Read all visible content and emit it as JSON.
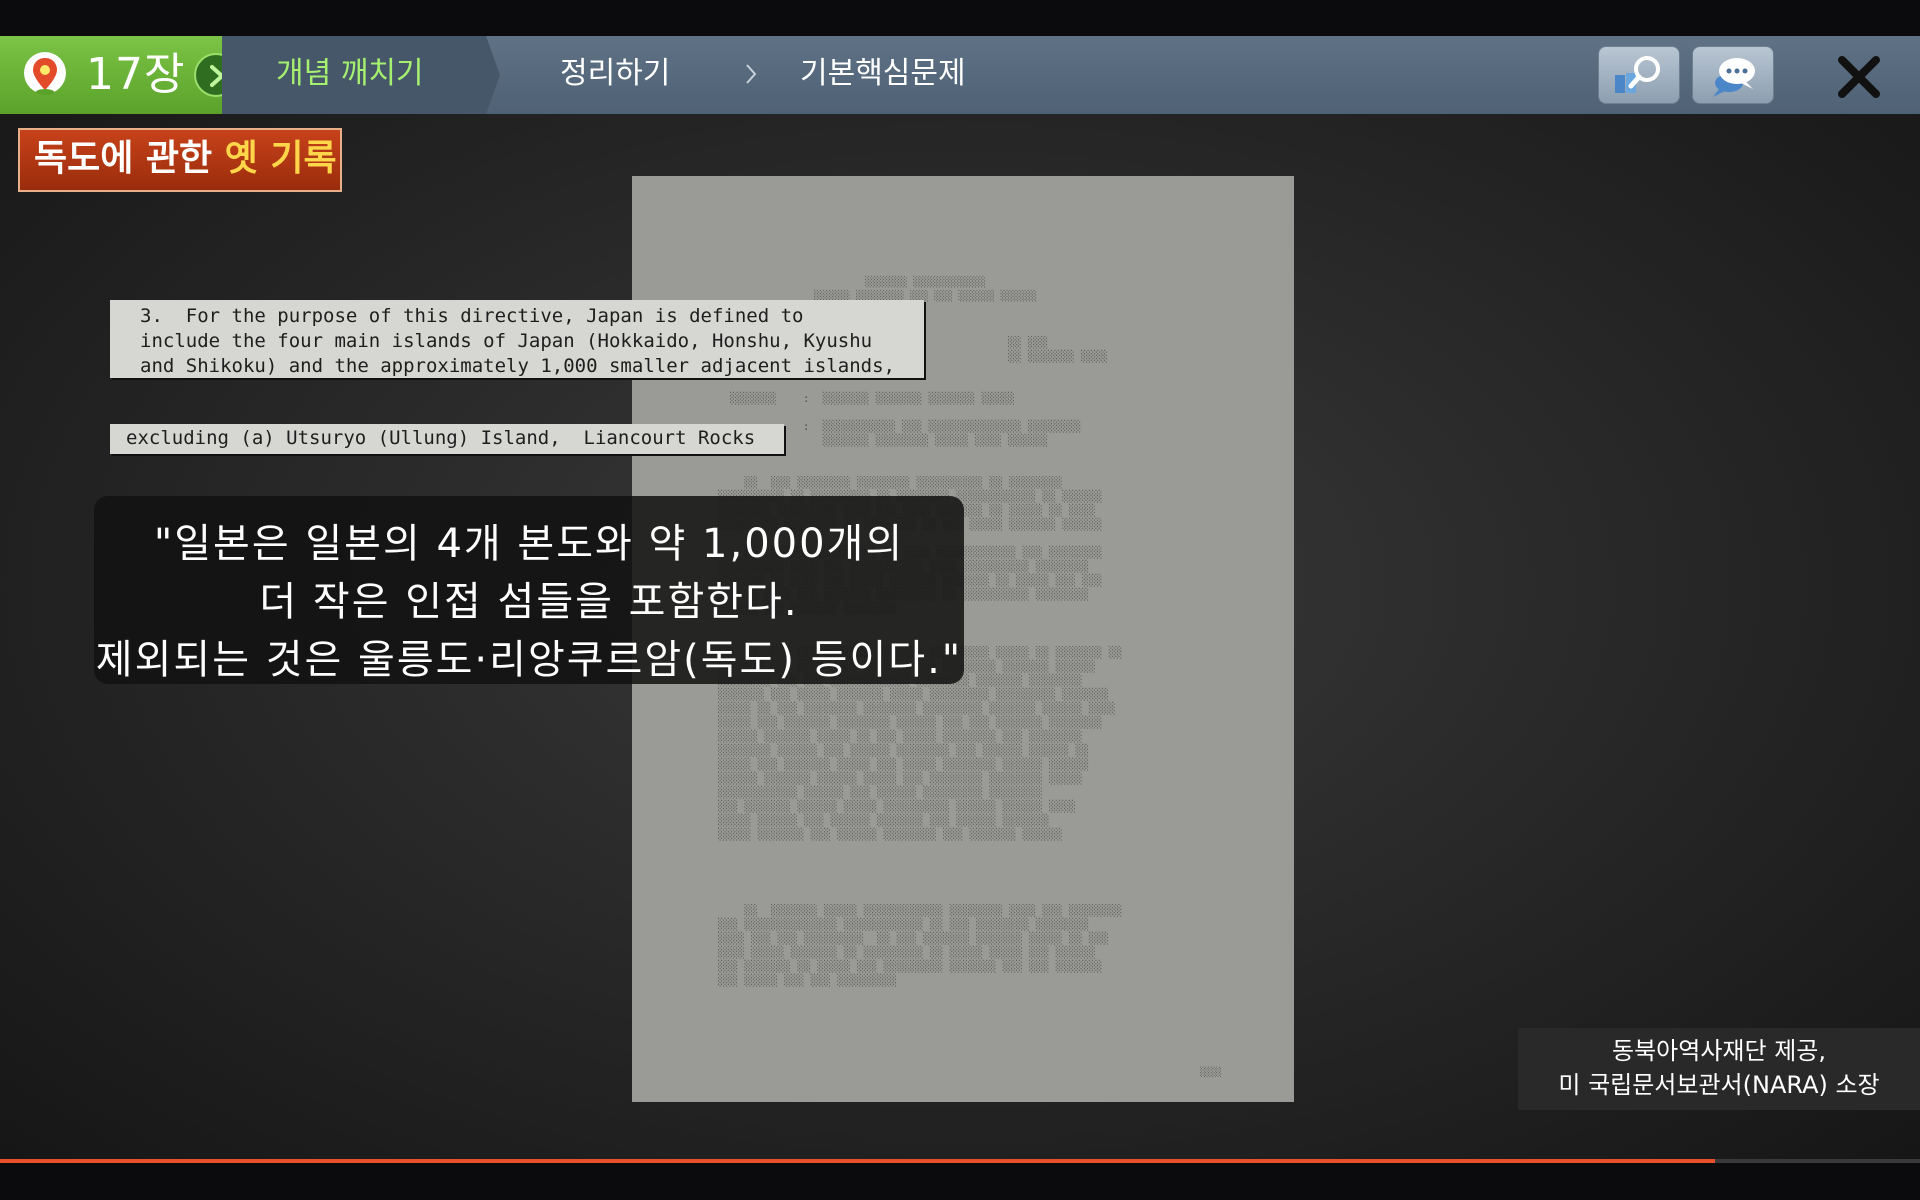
{
  "nav": {
    "chapter": "17장",
    "items": [
      {
        "label": "개념 깨치기",
        "active": true
      },
      {
        "label": "정리하기",
        "active": false
      },
      {
        "label": "기본핵심문제",
        "active": false
      }
    ],
    "accent_color": "#6ab536",
    "active_text_color": "#a6f070",
    "icons": [
      "map-pin-icon",
      "chevron-right-icon",
      "book-search-icon",
      "chat-bubble-icon",
      "close-icon"
    ]
  },
  "slide": {
    "title_prefix": "독도에 관한",
    "title_highlight": "옛 기록",
    "excerpt_1": "3.  For the purpose of this directive, Japan is defined to\ninclude the four main islands of Japan (Hokkaido, Honshu, Kyushu\nand Shikoku) and the approximately 1,000 smaller adjacent islands,",
    "excerpt_2": "excluding (a) Utsuryo (Ullung) Island,  Liancourt Rocks",
    "subtitle": [
      "\"일본은 일본의 4개 본도와 약 1,000개의",
      "더 작은 인접 섬들을 포함한다.",
      "제외되는 것은 울릉도·리앙쿠르암(독도) 등이다.\""
    ],
    "credit": [
      "동북아역사재단 제공,",
      "미 국립문서보관서(NARA) 소장"
    ]
  },
  "player": {
    "progress": 0.893,
    "progress_color": "#e8502a"
  }
}
